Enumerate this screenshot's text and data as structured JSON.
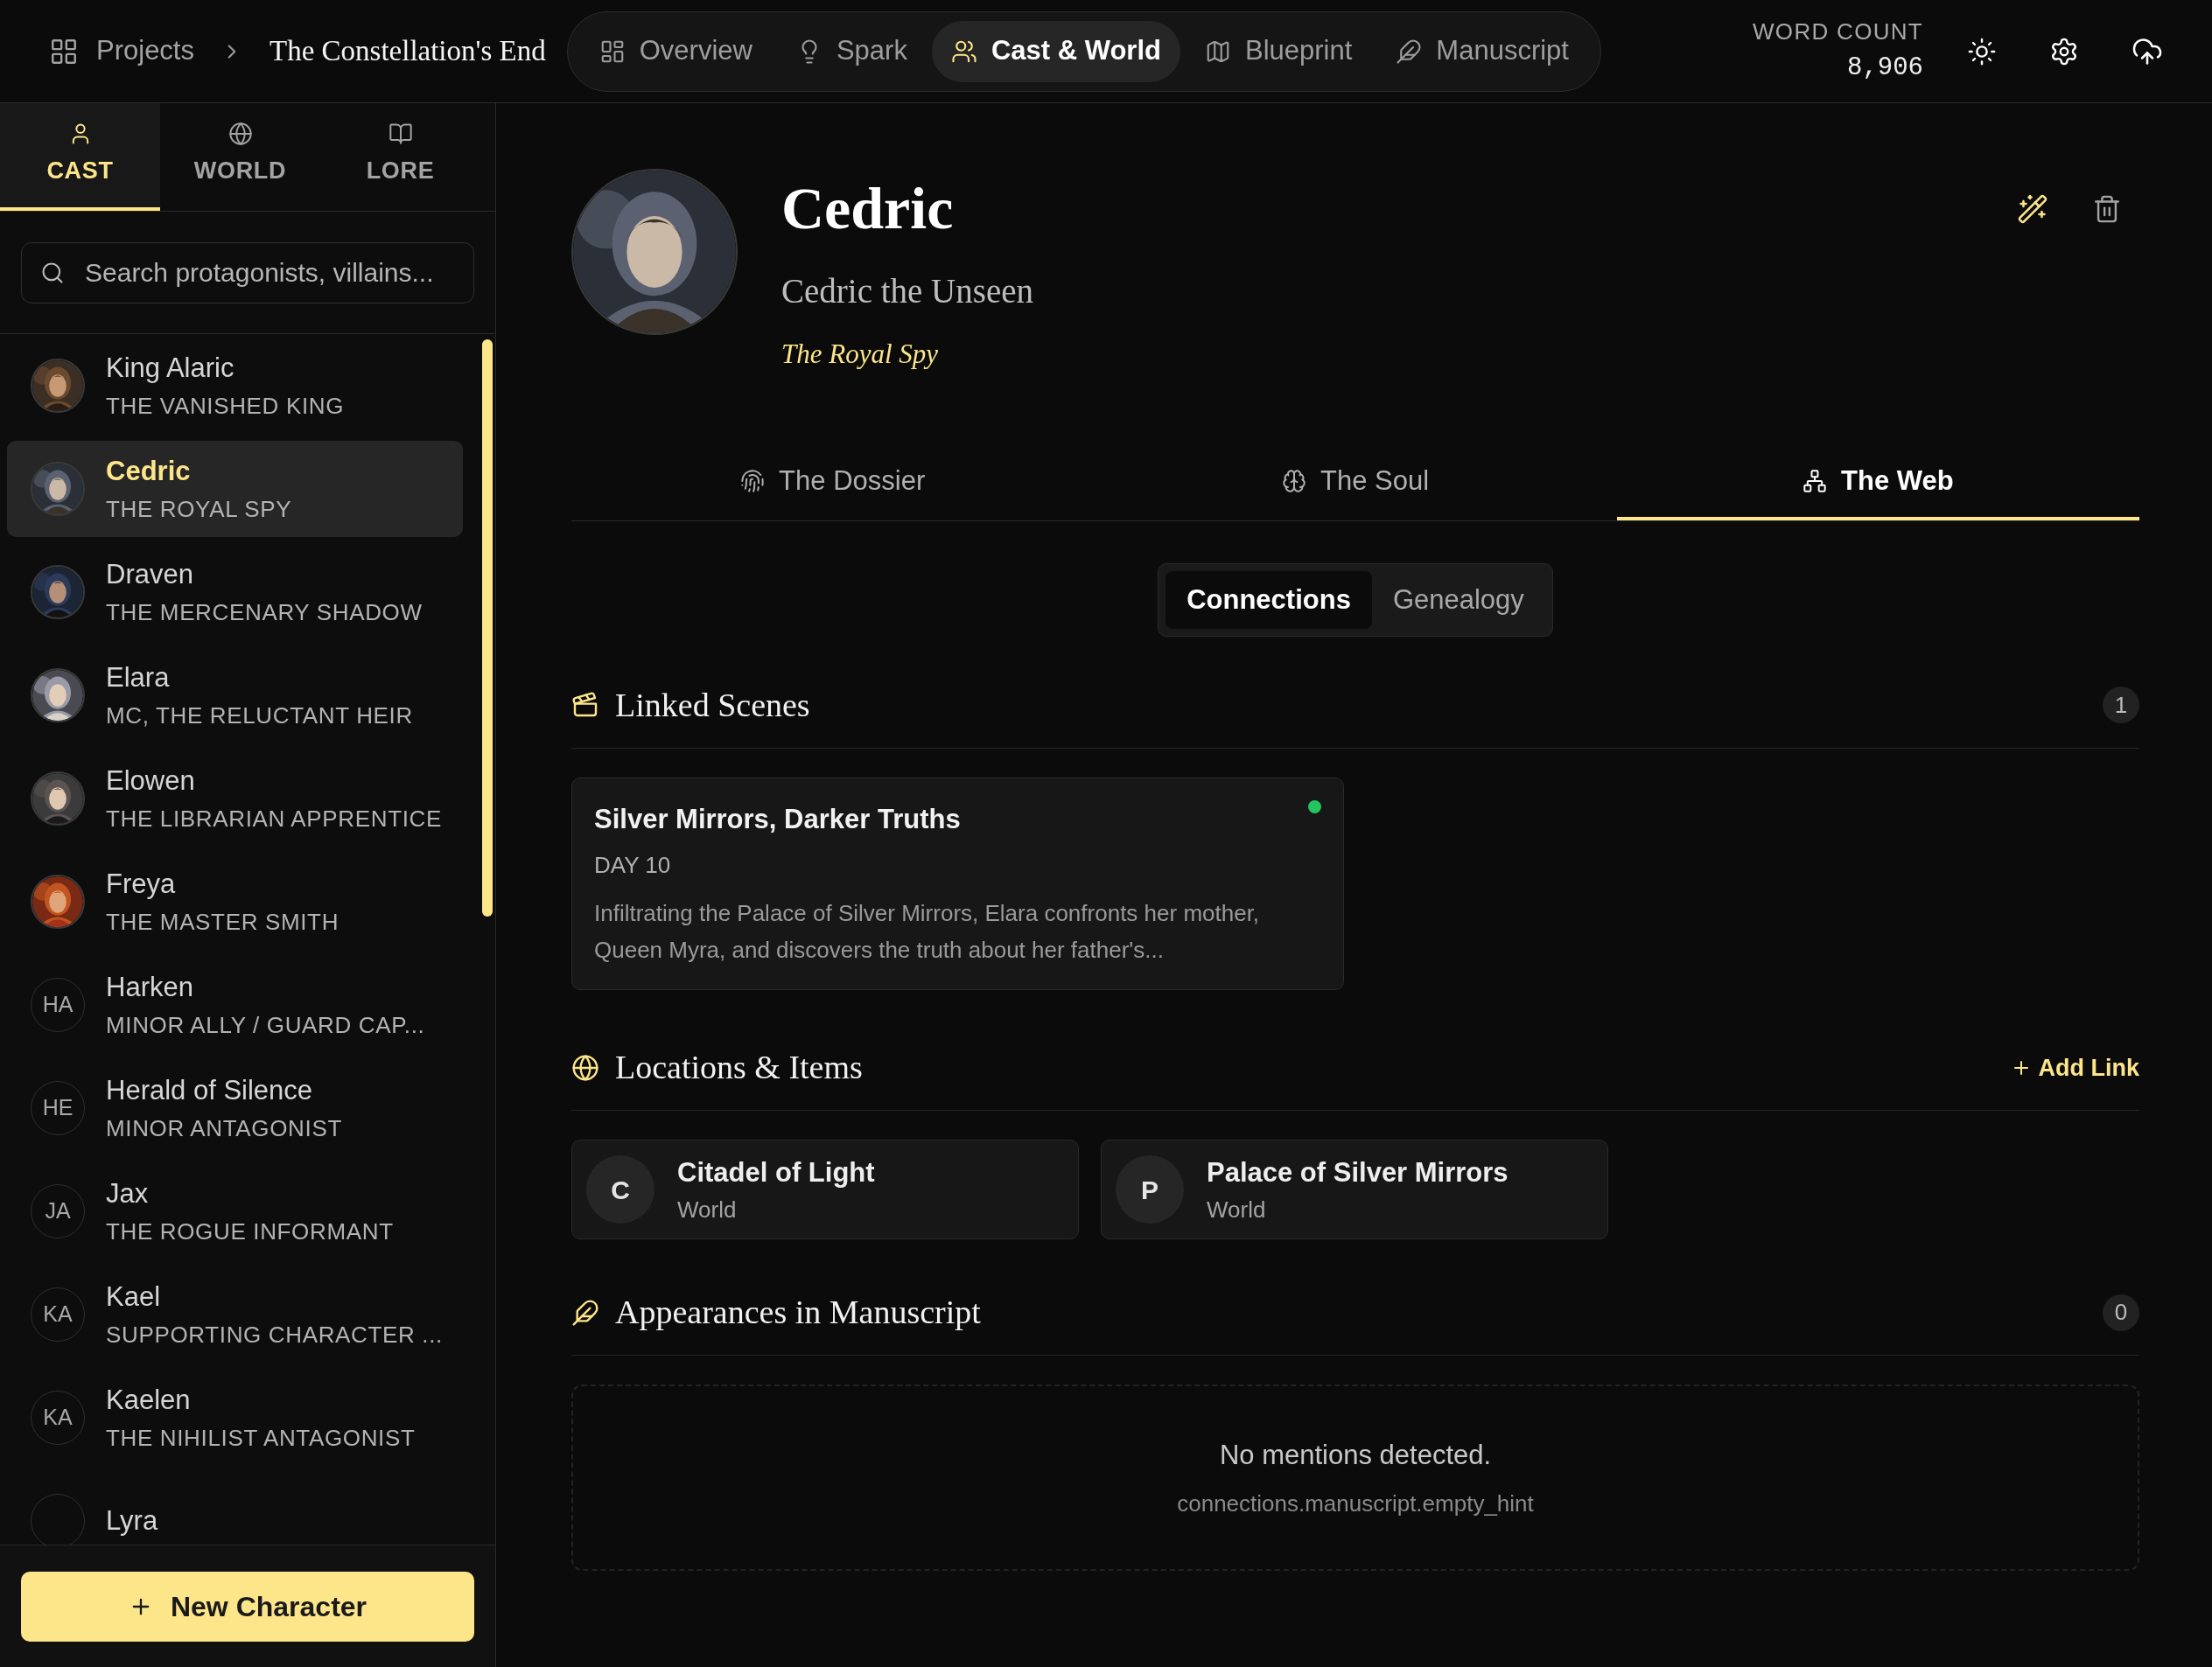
{
  "breadcrumb": {
    "root": "Projects",
    "project": "The Constellation's End"
  },
  "nav": [
    {
      "label": "Overview",
      "selected": false
    },
    {
      "label": "Spark",
      "selected": false
    },
    {
      "label": "Cast & World",
      "selected": true
    },
    {
      "label": "Blueprint",
      "selected": false
    },
    {
      "label": "Manuscript",
      "selected": false
    }
  ],
  "word_count": {
    "label": "WORD COUNT",
    "value": "8,906"
  },
  "sidebar": {
    "tabs": [
      {
        "label": "CAST",
        "selected": true
      },
      {
        "label": "WORLD",
        "selected": false
      },
      {
        "label": "LORE",
        "selected": false
      }
    ],
    "search": {
      "placeholder": "Search protagonists, villains..."
    },
    "characters": [
      {
        "name": "King Alaric",
        "role": "THE VANISHED KING",
        "selected": false
      },
      {
        "name": "Cedric",
        "role": "THE ROYAL SPY",
        "selected": true
      },
      {
        "name": "Draven",
        "role": "THE MERCENARY SHADOW",
        "selected": false
      },
      {
        "name": "Elara",
        "role": "MC, THE RELUCTANT HEIR",
        "selected": false
      },
      {
        "name": "Elowen",
        "role": "THE LIBRARIAN APPRENTICE",
        "selected": false
      },
      {
        "name": "Freya",
        "role": "THE MASTER SMITH",
        "selected": false
      },
      {
        "name": "Harken",
        "role": "MINOR ALLY / GUARD CAP...",
        "avatar": {
          "kind": "initials",
          "text": "HA"
        },
        "selected": false
      },
      {
        "name": "Herald of Silence",
        "role": "MINOR ANTAGONIST",
        "avatar": {
          "kind": "initials",
          "text": "HE"
        },
        "selected": false
      },
      {
        "name": "Jax",
        "role": "THE ROGUE INFORMANT",
        "avatar": {
          "kind": "initials",
          "text": "JA"
        },
        "selected": false
      },
      {
        "name": "Kael",
        "role": "SUPPORTING CHARACTER ...",
        "avatar": {
          "kind": "initials",
          "text": "KA"
        },
        "selected": false
      },
      {
        "name": "Kaelen",
        "role": "THE NIHILIST ANTAGONIST",
        "avatar": {
          "kind": "initials",
          "text": "KA"
        },
        "selected": false
      },
      {
        "name": "Lyra",
        "avatar": {
          "kind": "blank"
        },
        "selected": false
      }
    ],
    "new_button": "New Character"
  },
  "profile": {
    "name": "Cedric",
    "epithet": "Cedric the Unseen",
    "role": "The Royal Spy"
  },
  "tabs": [
    {
      "label": "The Dossier",
      "selected": false
    },
    {
      "label": "The Soul",
      "selected": false
    },
    {
      "label": "The Web",
      "selected": true
    }
  ],
  "subtabs": [
    {
      "label": "Connections",
      "selected": true
    },
    {
      "label": "Genealogy",
      "selected": false
    }
  ],
  "linked_scenes": {
    "title": "Linked Scenes",
    "count": "1",
    "scenes": [
      {
        "title": "Silver Mirrors, Darker Truths",
        "day": "DAY 10",
        "summary": "Infiltrating the Palace of Silver Mirrors, Elara confronts her mother, Queen Myra, and discovers the truth about her father's..."
      }
    ]
  },
  "locations": {
    "title": "Locations & Items",
    "action": "Add Link",
    "items": [
      {
        "initial": "C",
        "name": "Citadel of Light",
        "type": "World"
      },
      {
        "initial": "P",
        "name": "Palace of Silver Mirrors",
        "type": "World"
      }
    ]
  },
  "appearances": {
    "title": "Appearances in Manuscript",
    "count": "0",
    "empty": "No mentions detected.",
    "hint": "connections.manuscript.empty_hint"
  }
}
